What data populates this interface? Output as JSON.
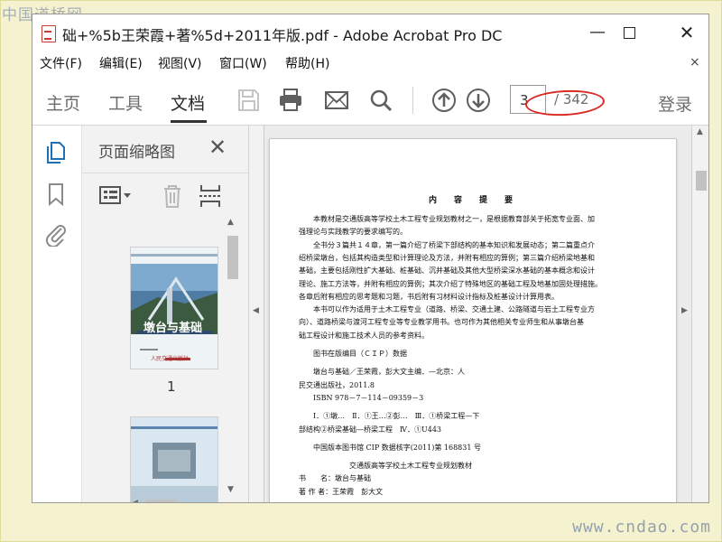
{
  "watermarks": {
    "top_left": "中国道桥网",
    "bottom_right": "www.cndao.com"
  },
  "window": {
    "title": "础+%5b王荣霞+著%5d+2011年版.pdf - Adobe Acrobat Pro DC",
    "minimize": "—",
    "close": "✕"
  },
  "menubar": {
    "items": [
      "文件(F)",
      "编辑(E)",
      "视图(V)",
      "窗口(W)",
      "帮助(H)"
    ],
    "close_doc": "×"
  },
  "toolbar": {
    "tabs": [
      "主页",
      "工具",
      "文档"
    ],
    "active_tab": "文档",
    "current_page": "3",
    "total_pages": "/ 342",
    "login": "登录",
    "icons": [
      "save-icon",
      "print-icon",
      "email-icon",
      "search-icon",
      "prev-page-icon",
      "next-page-icon"
    ]
  },
  "rail": {
    "icons": [
      "page-thumbnails-icon",
      "bookmark-icon",
      "attachment-icon"
    ]
  },
  "thumbnail_panel": {
    "title": "页面缩略图",
    "close": "✕",
    "thumb1_caption": "墩台与基础",
    "thumb1_publisher": "人民交通出版社",
    "page_label": "1"
  },
  "document": {
    "heading": "内　容　提　要",
    "lines": [
      "　　本教材是交通版高等学校土木工程专业规划教材之一，是根据教育部关于拓宽专业面、加",
      "强理论与实践教学的要求编写的。",
      "　　全书分３篇共１４章，第一篇介绍了桥梁下部结构的基本知识和发展动态；第二篇重点介",
      "绍桥梁墩台，包括其构造类型和计算理论及方法，并附有相应的算例；第三篇介绍桥梁地基和",
      "基础，主要包括刚性扩大基础、桩基础、沉井基础及其他大型桥梁深水基础的基本概念和设计",
      "理论、施工方法等，并附有相应的算例；其次介绍了特殊地区的基础工程及地基加固处理措施。",
      "各章后附有相应的思考题和习题，书后附有习材料设计指标及桩基设计计算用表。",
      "　　本书可以作为适用于土木工程专业（道路、桥梁、交通土建、公路隧道与岩土工程专业方",
      "向）、道路桥梁与渡河工程专业等专业教学用书。也可作为其他相关专业师生和从事墩台基",
      "础工程设计和施工技术人员的参考资料。",
      "",
      "　　图书在版编目（ＣＩＰ）数据",
      "",
      "　　墩台与基础／王荣霞，彭大文主编．—北京：人",
      "民交通出版社，2011.8",
      "　　ISBN 978－7－114－09359－3",
      "",
      "　　Ⅰ．①墩…　Ⅱ．①王…②彭…　Ⅲ．①桥梁工程—下",
      "部结构②桥梁基础—桥梁工程　Ⅳ．①U443",
      "",
      "　　中国版本图书馆 CIP 数据核字(2011)第 168831 号",
      "",
      "　　　　　　　交通版高等学校土木工程专业规划教材",
      "书　　名：墩台与基础",
      "著 作 者：王荣霞　彭大文"
    ]
  },
  "colors": {
    "highlight_ellipse": "#d92a22",
    "pdf_icon": "#c83a32",
    "rail_active": "#1f6fb5"
  }
}
